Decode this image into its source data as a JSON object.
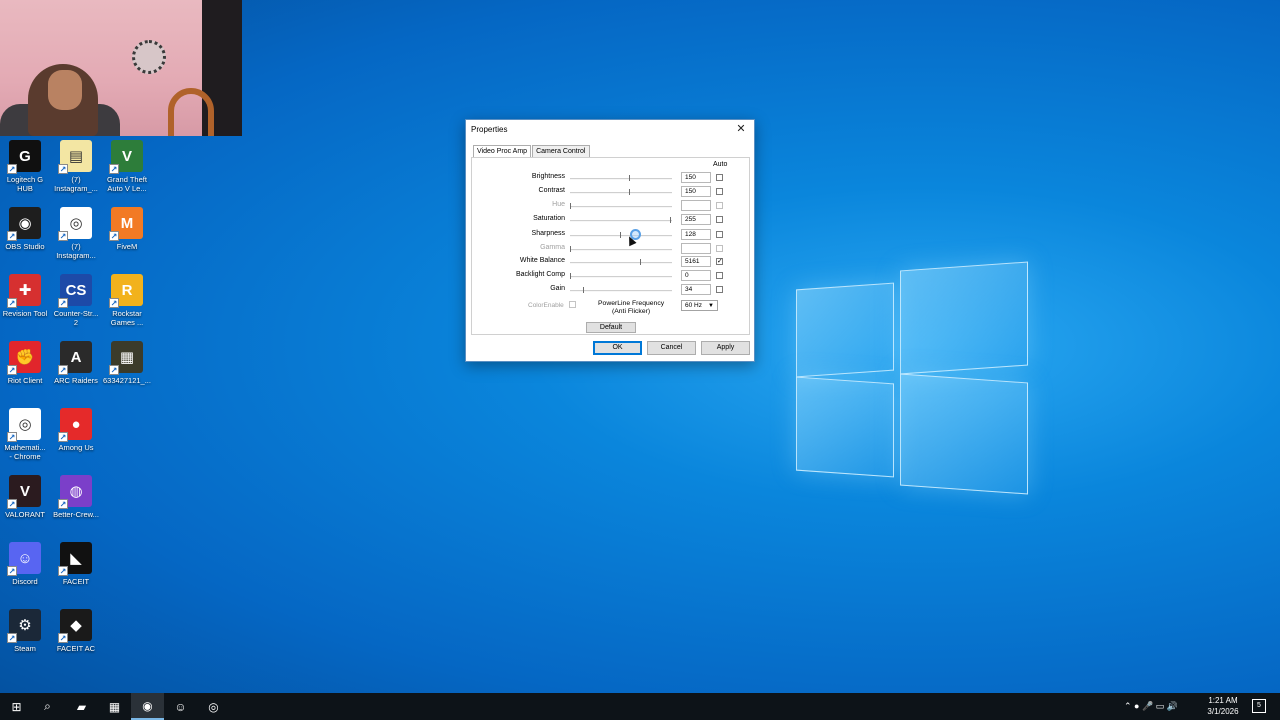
{
  "desktop": {
    "icons": [
      {
        "label": "Logitech G\nHUB",
        "glyph": "G",
        "bg": "#101010",
        "col": 0,
        "row": 0
      },
      {
        "label": "(7)\nInstagram_...",
        "glyph": "▤",
        "bg": "#f3e6a3",
        "col": 1,
        "row": 0
      },
      {
        "label": "Grand Theft\nAuto V Le...",
        "glyph": "V",
        "bg": "#2d7d3a",
        "col": 2,
        "row": 0
      },
      {
        "label": "OBS Studio",
        "glyph": "◉",
        "bg": "#1e1e1e",
        "col": 0,
        "row": 1
      },
      {
        "label": "(7)\nInstagram...",
        "glyph": "◎",
        "bg": "#ffffff",
        "col": 1,
        "row": 1
      },
      {
        "label": "FiveM",
        "glyph": "M",
        "bg": "#f27a24",
        "col": 2,
        "row": 1
      },
      {
        "label": "Revision Tool",
        "glyph": "✚",
        "bg": "#d63030",
        "col": 0,
        "row": 2
      },
      {
        "label": "Counter-Str...\n2",
        "glyph": "CS",
        "bg": "#1d4aa8",
        "col": 1,
        "row": 2
      },
      {
        "label": "Rockstar\nGames ...",
        "glyph": "R",
        "bg": "#f2b21c",
        "col": 2,
        "row": 2
      },
      {
        "label": "Riot Client",
        "glyph": "✊",
        "bg": "#e1262c",
        "col": 0,
        "row": 3
      },
      {
        "label": "ARC Raiders",
        "glyph": "A",
        "bg": "#2a2a2a",
        "col": 1,
        "row": 3
      },
      {
        "label": "633427121_...",
        "glyph": "▦",
        "bg": "#3b3b2a",
        "col": 2,
        "row": 3
      },
      {
        "label": "Mathemati...\n- Chrome",
        "glyph": "◎",
        "bg": "#ffffff",
        "col": 0,
        "row": 4
      },
      {
        "label": "Among Us",
        "glyph": "●",
        "bg": "#e52a2a",
        "col": 1,
        "row": 4
      },
      {
        "label": "VALORANT",
        "glyph": "V",
        "bg": "#2b1b1f",
        "col": 0,
        "row": 5
      },
      {
        "label": "Better-Crew...",
        "glyph": "◍",
        "bg": "#7b3fc9",
        "col": 1,
        "row": 5
      },
      {
        "label": "Discord",
        "glyph": "☺",
        "bg": "#5865f2",
        "col": 0,
        "row": 6
      },
      {
        "label": "FACEIT",
        "glyph": "◣",
        "bg": "#111111",
        "col": 1,
        "row": 6
      },
      {
        "label": "Steam",
        "glyph": "⚙",
        "bg": "#1b2838",
        "col": 0,
        "row": 7
      },
      {
        "label": "FACEIT AC",
        "glyph": "◆",
        "bg": "#1a1a1a",
        "col": 1,
        "row": 7
      }
    ]
  },
  "dialog": {
    "title": "Properties",
    "close_glyph": "✕",
    "tabs": [
      {
        "label": "Video Proc Amp",
        "active": true
      },
      {
        "label": "Camera Control",
        "active": false
      }
    ],
    "auto_header": "Auto",
    "properties": [
      {
        "label": "Brightness",
        "value": "150",
        "level": 0.59,
        "enabled": true,
        "auto": false
      },
      {
        "label": "Contrast",
        "value": "150",
        "level": 0.59,
        "enabled": true,
        "auto": false
      },
      {
        "label": "Hue",
        "value": "",
        "level": 0.0,
        "enabled": false,
        "auto": false
      },
      {
        "label": "Saturation",
        "value": "255",
        "level": 1.0,
        "enabled": true,
        "auto": false
      },
      {
        "label": "Sharpness",
        "value": "128",
        "level": 0.5,
        "enabled": true,
        "auto": false
      },
      {
        "label": "Gamma",
        "value": "",
        "level": 0.0,
        "enabled": false,
        "auto": false
      },
      {
        "label": "White Balance",
        "value": "5161",
        "level": 0.7,
        "enabled": true,
        "auto": true
      },
      {
        "label": "Backlight Comp",
        "value": "0",
        "level": 0.0,
        "enabled": true,
        "auto": false
      },
      {
        "label": "Gain",
        "value": "34",
        "level": 0.13,
        "enabled": true,
        "auto": false
      }
    ],
    "color_enable_label": "ColorEnable",
    "powerline_label_1": "PowerLine Frequency",
    "powerline_label_2": "(Anti Flicker)",
    "powerline_value": "60 Hz",
    "default_button": "Default",
    "ok_button": "OK",
    "cancel_button": "Cancel",
    "apply_button": "Apply"
  },
  "taskbar": {
    "items": [
      {
        "name": "start-button",
        "glyph": "⊞"
      },
      {
        "name": "search-button",
        "glyph": "⌕"
      },
      {
        "name": "file-explorer",
        "glyph": "▰"
      },
      {
        "name": "microsoft-store",
        "glyph": "▦"
      },
      {
        "name": "camera-app",
        "glyph": "◉"
      },
      {
        "name": "discord-app",
        "glyph": "☺"
      },
      {
        "name": "chrome-app",
        "glyph": "◎"
      }
    ],
    "tray_glyphs": "⌃ ● 🎤 ▭ 🔊",
    "clock_time": "1:21 AM",
    "clock_date": "3/1/2026",
    "notification_count": "5"
  }
}
